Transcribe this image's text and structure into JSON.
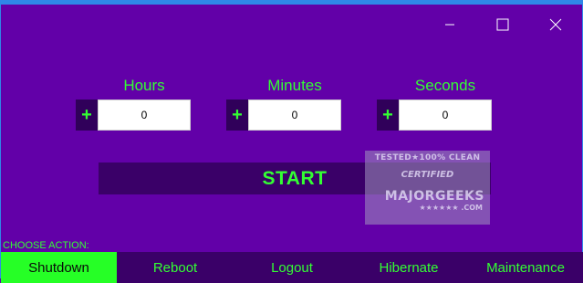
{
  "window": {
    "controls": {
      "minimize_icon": "minimize-icon",
      "maximize_icon": "maximize-icon",
      "close_icon": "close-icon"
    }
  },
  "timer": {
    "hours": {
      "label": "Hours",
      "plus": "+",
      "value": "0"
    },
    "minutes": {
      "label": "Minutes",
      "plus": "+",
      "value": "0"
    },
    "seconds": {
      "label": "Seconds",
      "plus": "+",
      "value": "0"
    }
  },
  "start_label": "START",
  "choose_action_label": "CHOOSE ACTION:",
  "actions": [
    {
      "label": "Shutdown",
      "selected": true
    },
    {
      "label": "Reboot",
      "selected": false
    },
    {
      "label": "Logout",
      "selected": false
    },
    {
      "label": "Hibernate",
      "selected": false
    },
    {
      "label": "Maintenance",
      "selected": false
    }
  ],
  "watermark": {
    "top": "TESTED★100% CLEAN",
    "middle": "CERTIFIED",
    "brand": "MAJORGEEKS",
    "sub": "★★★★★★ .COM"
  },
  "colors": {
    "background": "#6200a8",
    "accent_text": "#33ff33",
    "dark_button": "#3a0068",
    "selected_action": "#26ff26",
    "window_border": "#2f86e8"
  }
}
